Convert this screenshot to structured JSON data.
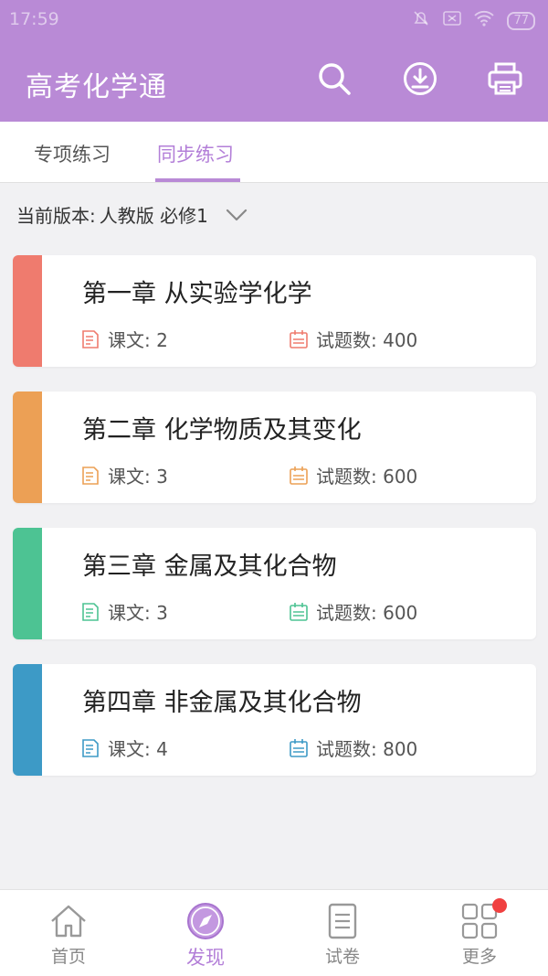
{
  "status": {
    "time": "17:59",
    "battery": "77"
  },
  "header": {
    "title": "高考化学通",
    "icons": [
      "search-icon",
      "download-icon",
      "print-icon"
    ]
  },
  "tabs": [
    {
      "label": "专项练习",
      "active": false
    },
    {
      "label": "同步练习",
      "active": true
    }
  ],
  "version": {
    "label": "当前版本:",
    "value": "人教版 必修1"
  },
  "cards": [
    {
      "title": "第一章 从实验学化学",
      "lessons": "课文: 2",
      "questions": "试题数: 400",
      "color": "#ef7b6e"
    },
    {
      "title": "第二章 化学物质及其变化",
      "lessons": "课文: 3",
      "questions": "试题数: 600",
      "color": "#eca055"
    },
    {
      "title": "第三章 金属及其化合物",
      "lessons": "课文: 3",
      "questions": "试题数: 600",
      "color": "#4dc393"
    },
    {
      "title": "第四章 非金属及其化合物",
      "lessons": "课文: 4",
      "questions": "试题数: 800",
      "color": "#3d9ac6"
    }
  ],
  "nav": [
    {
      "label": "首页",
      "icon": "home-icon",
      "active": false
    },
    {
      "label": "发现",
      "icon": "compass-icon",
      "active": true
    },
    {
      "label": "试卷",
      "icon": "paper-icon",
      "active": false
    },
    {
      "label": "更多",
      "icon": "grid-icon",
      "active": false,
      "badge": true
    }
  ],
  "colors": {
    "accent": "#b98ad6",
    "active_text": "#b37fd8"
  }
}
